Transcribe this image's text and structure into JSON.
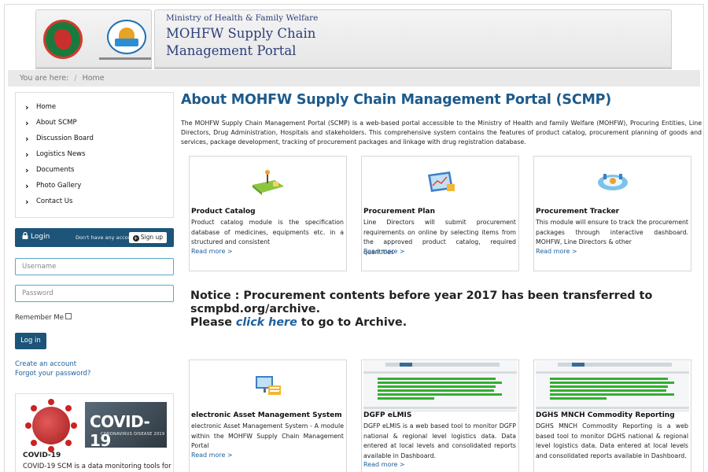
{
  "header": {
    "ministry": "Ministry of Health & Family Welfare",
    "portal_name": "MOHFW Supply Chain Management Portal"
  },
  "breadcrumb": {
    "prefix": "You are here:",
    "separator": "/",
    "current": "Home"
  },
  "sidebar": {
    "items": [
      {
        "label": "Home"
      },
      {
        "label": "About SCMP"
      },
      {
        "label": "Discussion Board"
      },
      {
        "label": "Logistics News"
      },
      {
        "label": "Documents"
      },
      {
        "label": "Photo Gallery"
      },
      {
        "label": "Contact Us"
      }
    ]
  },
  "login": {
    "title": "Login",
    "no_account": "Don't have any account?",
    "signup": "Sign up",
    "username_placeholder": "Username",
    "password_placeholder": "Password",
    "remember": "Remember Me",
    "login_button": "Log in",
    "create_account": "Create an account",
    "forgot_password": "Forgot your password?"
  },
  "covid": {
    "banner_big": "COVID-19",
    "banner_small": "CORONAVIRUS DISEASE 2019",
    "title": "COVID-19",
    "text": "COVID-19 SCM is a data monitoring tools for"
  },
  "main": {
    "title": "About MOHFW Supply Chain Management Portal (SCMP)",
    "intro": "The MOHFW Supply Chain Management Portal (SCMP) is a web-based portal accessible to the Ministry of Health and family Welfare (MOHFW), Procuring Entities, Line Directors, Drug Administration, Hospitals and stakeholders. This comprehensive system contains the features of product catalog, procurement planning of goods and services, package development, tracking of procurement packages and linkage with drug registration database.",
    "read_more": "Read more >",
    "cards": [
      {
        "title": "Product Catalog",
        "text": "Product catalog module is the specification database of medicines, equipments etc. in a structured and consistent"
      },
      {
        "title": "Procurement Plan",
        "text": "Line Directors will submit procurement requirements on online by selecting items from the approved product catalog, required quantities"
      },
      {
        "title": "Procurement Tracker",
        "text": "This module will ensure to track the procurement packages through interactive dashboard. MOHFW, Line Directors & other"
      },
      {
        "title": "electronic Asset Management System",
        "text": "electronic Asset Management System - A module within the MOHFW Supply Chain Management Portal"
      },
      {
        "title": "DGFP eLMIS",
        "text": "DGFP eLMIS is a web based tool to monitor DGFP national & regional level logistics data. Data entered at local levels and consolidated reports available in Dashboard."
      },
      {
        "title": "DGHS MNCH Commodity Reporting",
        "text": "DGHS MNCH Commodity Reporting is a web based tool to monitor DGHS national & regional level logistics data. Data entered at local levels and consolidated reports available in Dashboard."
      }
    ],
    "notice_line1": "Notice : Procurement contents before year 2017 has been transferred to scmpbd.org/archive.",
    "notice_please": "Please",
    "notice_click": "click here",
    "notice_rest": "to go to Archive."
  },
  "colors": {
    "brand": "#1d5479",
    "title": "#1d5a8b",
    "link": "#1d5f9e"
  },
  "icons": [
    "chevron-right-icon",
    "lock-icon",
    "plus-circle-icon",
    "checkbox-icon"
  ]
}
